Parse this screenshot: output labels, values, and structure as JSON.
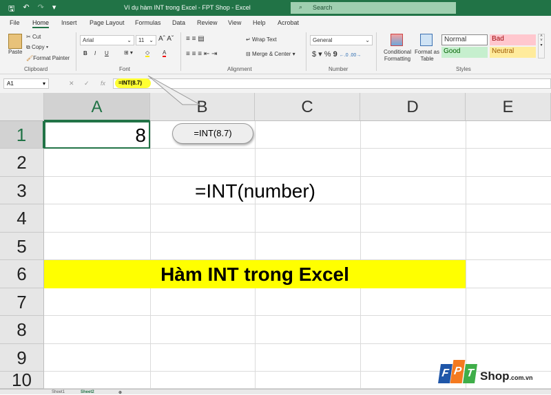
{
  "window": {
    "title": "Ví dụ hàm INT trong Excel - FPT Shop  -  Excel",
    "search_placeholder": "Search"
  },
  "menu": [
    "File",
    "Home",
    "Insert",
    "Page Layout",
    "Formulas",
    "Data",
    "Review",
    "View",
    "Help",
    "Acrobat"
  ],
  "ribbon": {
    "clipboard": {
      "paste": "Paste",
      "cut": "Cut",
      "copy": "Copy",
      "format_painter": "Format Painter",
      "label": "Clipboard"
    },
    "font": {
      "name": "Arial",
      "size": "11",
      "bold": "B",
      "italic": "I",
      "underline": "U",
      "label": "Font"
    },
    "alignment": {
      "wrap": "Wrap Text",
      "merge": "Merge & Center",
      "label": "Alignment"
    },
    "number": {
      "format": "General",
      "currency": "$",
      "percent": "%",
      "comma": "9",
      "label": "Number"
    },
    "styles": {
      "conditional": "Conditional Formatting",
      "format_table": "Format as Table",
      "normal": "Normal",
      "bad": "Bad",
      "good": "Good",
      "neutral": "Neutral",
      "label": "Styles"
    }
  },
  "formula_bar": {
    "cell_ref": "A1",
    "fx": "fx",
    "formula": "=INT(8.7)"
  },
  "columns": [
    "A",
    "B",
    "C",
    "D",
    "E"
  ],
  "rows": [
    "1",
    "2",
    "3",
    "4",
    "5",
    "6",
    "7",
    "8",
    "9",
    "10"
  ],
  "cells": {
    "A1": "8",
    "B3": "=INT(number)",
    "A6": "Hàm INT trong Excel"
  },
  "callout": "=INT(8.7)",
  "sheets": [
    "Sheet1",
    "Sheet2"
  ],
  "logo": {
    "text": "Shop",
    "suffix": ".com.vn",
    "letters": "FPT"
  },
  "colors": {
    "excel_green": "#217346",
    "highlight": "#ffff00"
  }
}
